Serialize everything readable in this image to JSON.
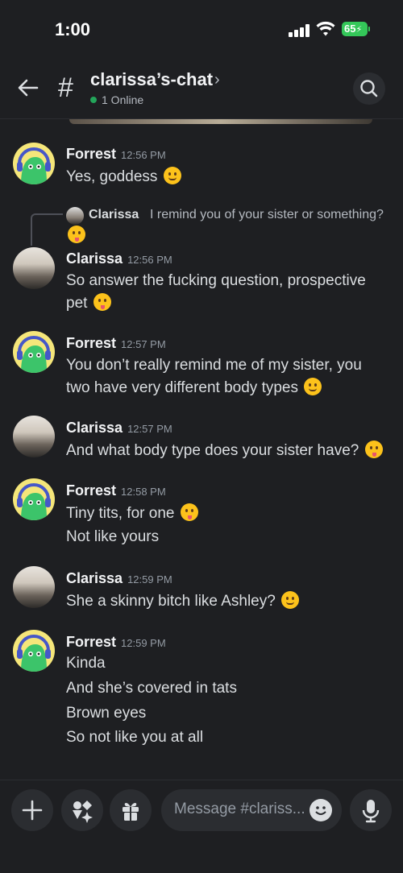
{
  "status_bar": {
    "time": "1:00",
    "battery": "65"
  },
  "header": {
    "channel_name": "clarissa’s-chat",
    "online_text": "1 Online",
    "chevron": "›"
  },
  "messages": [
    {
      "author": "Forrest",
      "time": "12:56 PM",
      "lines": [
        "Yes, goddess"
      ]
    },
    {
      "reply": {
        "author": "Clarissa",
        "text": "I remind you of your sister or something?"
      },
      "author": "Clarissa",
      "time": "12:56 PM",
      "lines": [
        "So answer the fucking question, prospective",
        "pet"
      ]
    },
    {
      "author": "Forrest",
      "time": "12:57 PM",
      "lines": [
        "You don’t really remind me of my sister, you",
        "two have very different body types"
      ]
    },
    {
      "author": "Clarissa",
      "time": "12:57 PM",
      "lines": [
        "And what body type does your sister have?"
      ]
    },
    {
      "author": "Forrest",
      "time": "12:58 PM",
      "lines": [
        "Tiny tits, for one",
        "Not like yours"
      ]
    },
    {
      "author": "Clarissa",
      "time": "12:59 PM",
      "lines": [
        "She a skinny bitch like Ashley?"
      ]
    },
    {
      "author": "Forrest",
      "time": "12:59 PM",
      "lines": [
        "Kinda",
        "And she’s covered in tats",
        "Brown eyes",
        "So not like you at all"
      ]
    }
  ],
  "composer": {
    "placeholder": "Message #clariss..."
  },
  "colors": {
    "background": "#1e1f22",
    "online": "#23a55a",
    "battery": "#34c759"
  },
  "icons": [
    "back-arrow-icon",
    "hash-icon",
    "search-icon",
    "plus-icon",
    "apps-icon",
    "gift-icon",
    "emoji-icon",
    "microphone-icon"
  ]
}
